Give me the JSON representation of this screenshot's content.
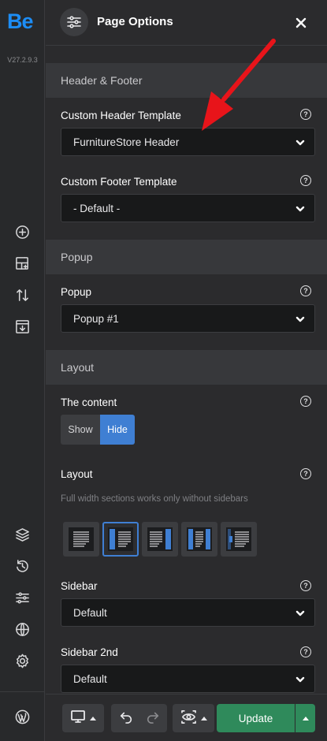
{
  "rail": {
    "logo": "Be",
    "version": "V27.2.9.3",
    "icons": [
      "plus-circle-icon",
      "add-section-icon",
      "sort-icon",
      "import-icon",
      "layers-icon",
      "history-icon",
      "options-icon",
      "globe-icon",
      "settings-icon",
      "wordpress-icon"
    ]
  },
  "header": {
    "title": "Page Options",
    "icon": "sliders-icon",
    "close_icon": "close-icon"
  },
  "sections": {
    "header_footer": {
      "title": "Header & Footer",
      "custom_header_label": "Custom Header Template",
      "custom_header_value": "FurnitureStore Header",
      "custom_footer_label": "Custom Footer Template",
      "custom_footer_value": "- Default -"
    },
    "popup": {
      "title": "Popup",
      "popup_label": "Popup",
      "popup_value": "Popup #1"
    },
    "layout": {
      "title": "Layout",
      "content_label": "The content",
      "content_options": [
        "Show",
        "Hide"
      ],
      "content_selected": "Hide",
      "layout_label": "Layout",
      "layout_hint": "Full width sections works only without sidebars",
      "layout_options": [
        "no-sidebar",
        "left-sidebar",
        "right-sidebar",
        "both-sidebars",
        "offcanvas-sidebar"
      ],
      "layout_selected": "left-sidebar",
      "sidebar_label": "Sidebar",
      "sidebar_value": "Default",
      "sidebar2_label": "Sidebar 2nd",
      "sidebar2_value": "Default"
    }
  },
  "help_glyph": "?",
  "bottom": {
    "update_label": "Update"
  },
  "colors": {
    "accent": "#3f7fd3",
    "update": "#2f8a5b",
    "annotation_arrow": "#e8141a",
    "logo": "#1d8df5"
  }
}
